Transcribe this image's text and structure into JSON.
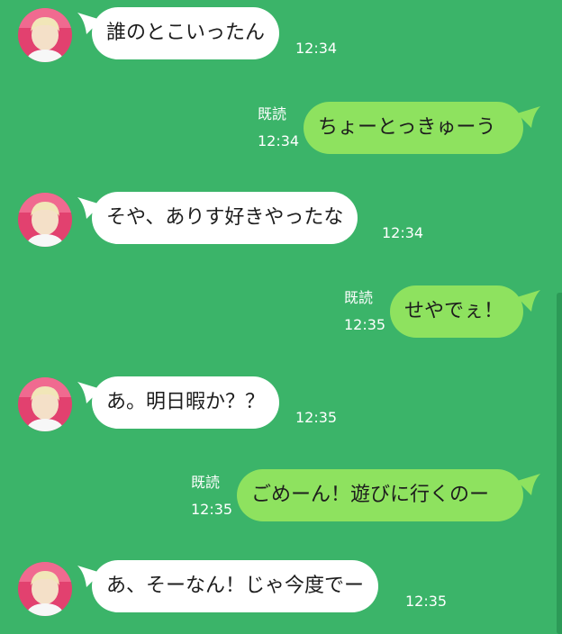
{
  "messages": [
    {
      "side": "in",
      "text": "誰のとこいったん",
      "time": "12:34"
    },
    {
      "side": "out",
      "text": "ちょーとっきゅーう",
      "time": "12:34",
      "read": "既読"
    },
    {
      "side": "in",
      "text": "そや、ありす好きやったな",
      "time": "12:34"
    },
    {
      "side": "out",
      "text": "せやでぇ！",
      "time": "12:35",
      "read": "既読"
    },
    {
      "side": "in",
      "text": "あ。明日暇か？？",
      "time": "12:35"
    },
    {
      "side": "out",
      "text": "ごめーん！遊びに行くのー",
      "time": "12:35",
      "read": "既読"
    },
    {
      "side": "in",
      "text": "あ、そーなん！じゃ今度でー",
      "time": "12:35"
    }
  ],
  "colors": {
    "background": "#3bb469",
    "incoming_bubble": "#ffffff",
    "outgoing_bubble": "#8ee25f",
    "meta_text": "#ffffff"
  }
}
